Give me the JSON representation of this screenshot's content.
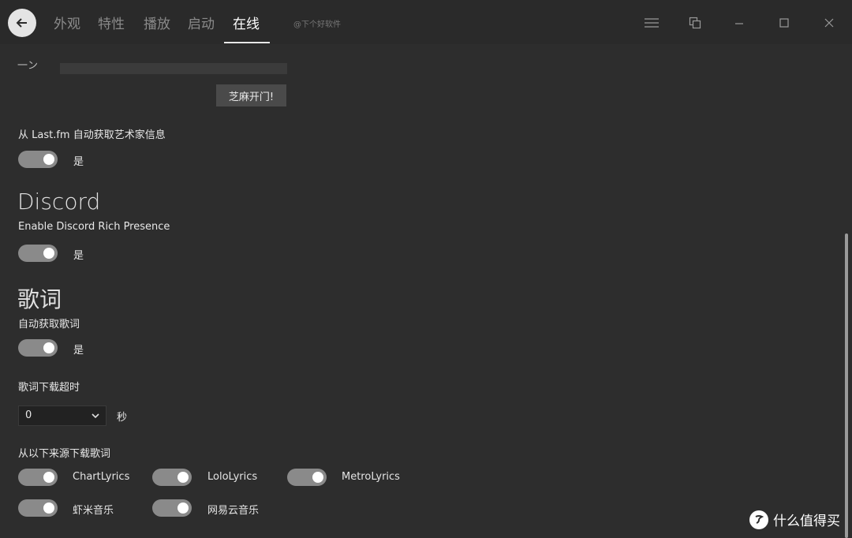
{
  "header": {
    "tabs": [
      {
        "label": "外观"
      },
      {
        "label": "特性"
      },
      {
        "label": "播放"
      },
      {
        "label": "启动"
      },
      {
        "label": "在线"
      }
    ],
    "active_tab": "在线",
    "watermark": "@下个好软件"
  },
  "lastfm": {
    "partial_label": "一ン",
    "open_button": "芝麻开门!",
    "auto_fetch_label": "从 Last.fm 自动获取艺术家信息",
    "toggle_text": "是",
    "toggle_on": true
  },
  "discord": {
    "section_title": "Discord",
    "rich_presence_label": "Enable Discord Rich Presence",
    "toggle_text": "是",
    "toggle_on": true
  },
  "lyrics": {
    "section_title": "歌词",
    "auto_fetch_label": "自动获取歌词",
    "toggle_text": "是",
    "toggle_on": true,
    "timeout_label": "歌词下载超时",
    "timeout_value": "0",
    "timeout_unit": "秒",
    "sources_label": "从以下来源下载歌词",
    "sources": [
      {
        "name": "ChartLyrics",
        "on": true
      },
      {
        "name": "LoloLyrics",
        "on": true
      },
      {
        "name": "MetroLyrics",
        "on": true
      },
      {
        "name": "虾米音乐",
        "on": true
      },
      {
        "name": "网易云音乐",
        "on": true
      }
    ]
  },
  "watermark_brand": {
    "text": "什么值得买",
    "icon": "smzdm-logo-icon"
  },
  "icons": {
    "back": "back-arrow-icon",
    "menu": "hamburger-menu-icon",
    "miniplayer": "miniplayer-icon",
    "minimize": "minimize-icon",
    "maximize": "maximize-icon",
    "close": "close-icon",
    "dropdown": "chevron-down-icon"
  },
  "colors": {
    "background": "#2d2d2d",
    "titlebar": "#2a2a2a",
    "toggle_track": "#8a8a8a",
    "active_tab": "#ffffff",
    "inactive_tab": "#8a8a8a"
  }
}
